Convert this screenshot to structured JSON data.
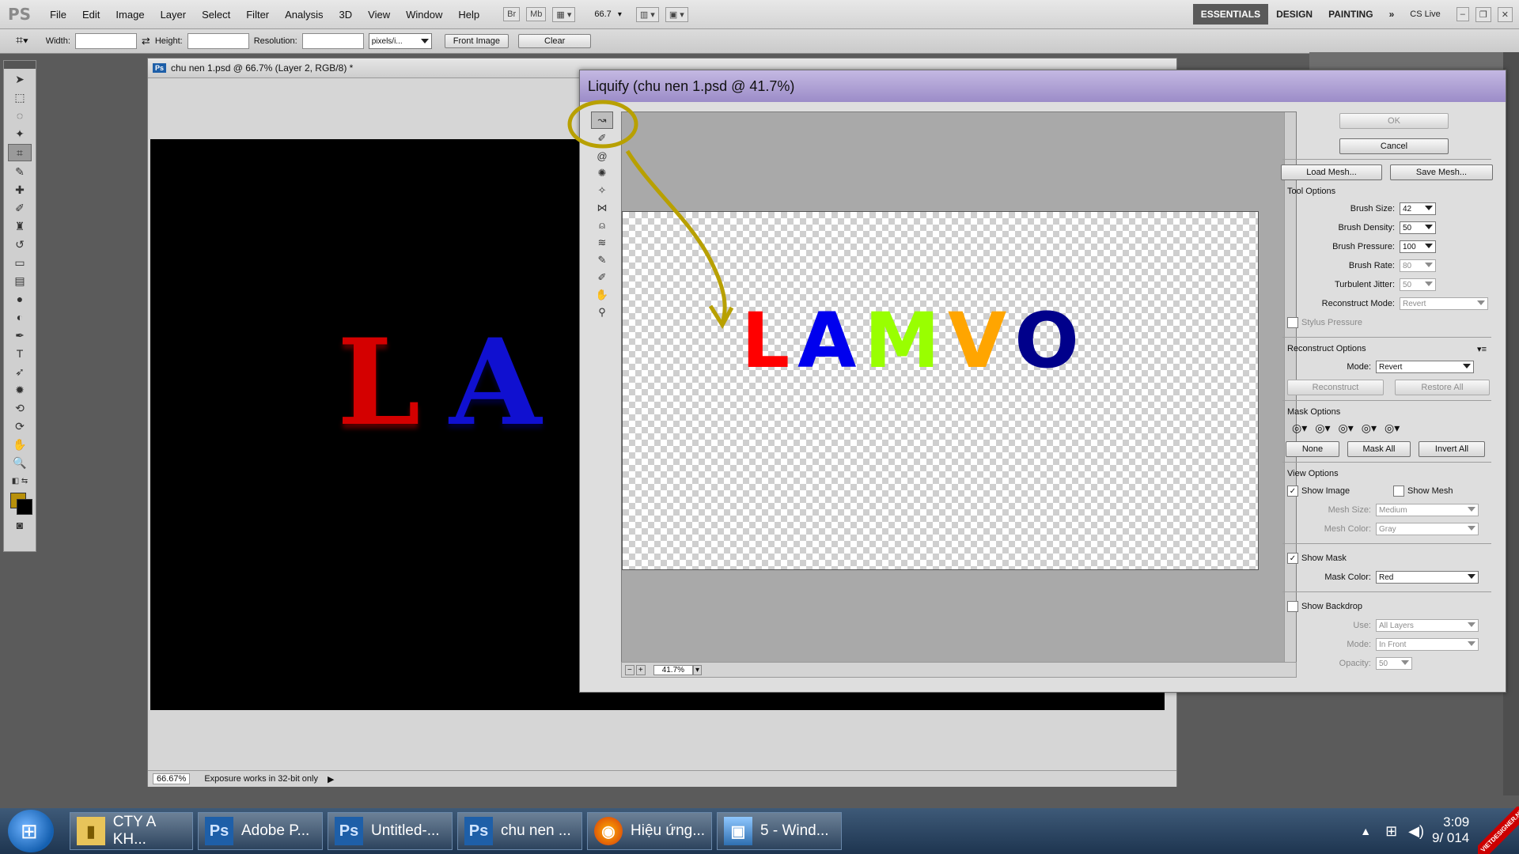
{
  "app": {
    "logo": "PS"
  },
  "menu": [
    "File",
    "Edit",
    "Image",
    "Layer",
    "Select",
    "Filter",
    "Analysis",
    "3D",
    "View",
    "Window",
    "Help"
  ],
  "menubar_extras": {
    "br": "Br",
    "mb": "Mb",
    "zoom": "66.7"
  },
  "workspaces": {
    "essentials": "ESSENTIALS",
    "design": "DESIGN",
    "painting": "PAINTING",
    "more": "»",
    "cslive": "CS Live"
  },
  "options_bar": {
    "width_label": "Width:",
    "height_label": "Height:",
    "resolution_label": "Resolution:",
    "units": "pixels/i...",
    "front_image": "Front Image",
    "clear": "Clear"
  },
  "document": {
    "title": "chu nen 1.psd @ 66.7% (Layer 2, RGB/8) *",
    "zoom": "66.67%",
    "status": "Exposure works in 32-bit only",
    "canvas_text": [
      "L",
      "A"
    ]
  },
  "liquify": {
    "title": "Liquify (chu nen 1.psd @ 41.7%)",
    "ok": "OK",
    "cancel": "Cancel",
    "load_mesh": "Load Mesh...",
    "save_mesh": "Save Mesh...",
    "tool_options": {
      "header": "Tool Options",
      "brush_size": {
        "label": "Brush Size:",
        "value": "42"
      },
      "brush_density": {
        "label": "Brush Density:",
        "value": "50"
      },
      "brush_pressure": {
        "label": "Brush Pressure:",
        "value": "100"
      },
      "brush_rate": {
        "label": "Brush Rate:",
        "value": "80"
      },
      "turbulent_jitter": {
        "label": "Turbulent Jitter:",
        "value": "50"
      },
      "reconstruct_mode": {
        "label": "Reconstruct Mode:",
        "value": "Revert"
      },
      "stylus_pressure": "Stylus Pressure"
    },
    "reconstruct_options": {
      "header": "Reconstruct Options",
      "mode_label": "Mode:",
      "mode_value": "Revert",
      "reconstruct": "Reconstruct",
      "restore_all": "Restore All"
    },
    "mask_options": {
      "header": "Mask Options",
      "none": "None",
      "mask_all": "Mask All",
      "invert_all": "Invert All"
    },
    "view_options": {
      "header": "View Options",
      "show_image": "Show Image",
      "show_mesh": "Show Mesh",
      "mesh_size_label": "Mesh Size:",
      "mesh_size_value": "Medium",
      "mesh_color_label": "Mesh Color:",
      "mesh_color_value": "Gray",
      "show_mask": "Show Mask",
      "mask_color_label": "Mask Color:",
      "mask_color_value": "Red",
      "show_backdrop": "Show Backdrop",
      "use_label": "Use:",
      "use_value": "All Layers",
      "mode_label": "Mode:",
      "mode_value": "In Front",
      "opacity_label": "Opacity:",
      "opacity_value": "50"
    },
    "preview_zoom": "41.7%",
    "image_letters": [
      {
        "char": "L",
        "color": "#ff0000"
      },
      {
        "char": "A",
        "color": "#0000ee"
      },
      {
        "char": "M",
        "color": "#99ff00"
      },
      {
        "char": "V",
        "color": "#ffa500"
      },
      {
        "char": "O",
        "color": "#00008b"
      }
    ]
  },
  "taskbar": {
    "tasks": [
      {
        "label": "CTY A KH...",
        "icon": "folder-icon"
      },
      {
        "label": "Adobe P...",
        "icon": "ps-icon"
      },
      {
        "label": "Untitled-...",
        "icon": "ps-icon"
      },
      {
        "label": "chu nen ...",
        "icon": "ps-icon"
      },
      {
        "label": "Hiệu ứng...",
        "icon": "firefox-icon"
      },
      {
        "label": "5 - Wind...",
        "icon": "photo-viewer-icon"
      }
    ],
    "clock_time": "3:09",
    "clock_date": "9/  014",
    "watermark": "VIETDESIGNER.NET"
  },
  "colors": {
    "annotation": "#b8a000",
    "foreground_swatch": "#b8900a",
    "dialog_title": "#a898d0"
  }
}
